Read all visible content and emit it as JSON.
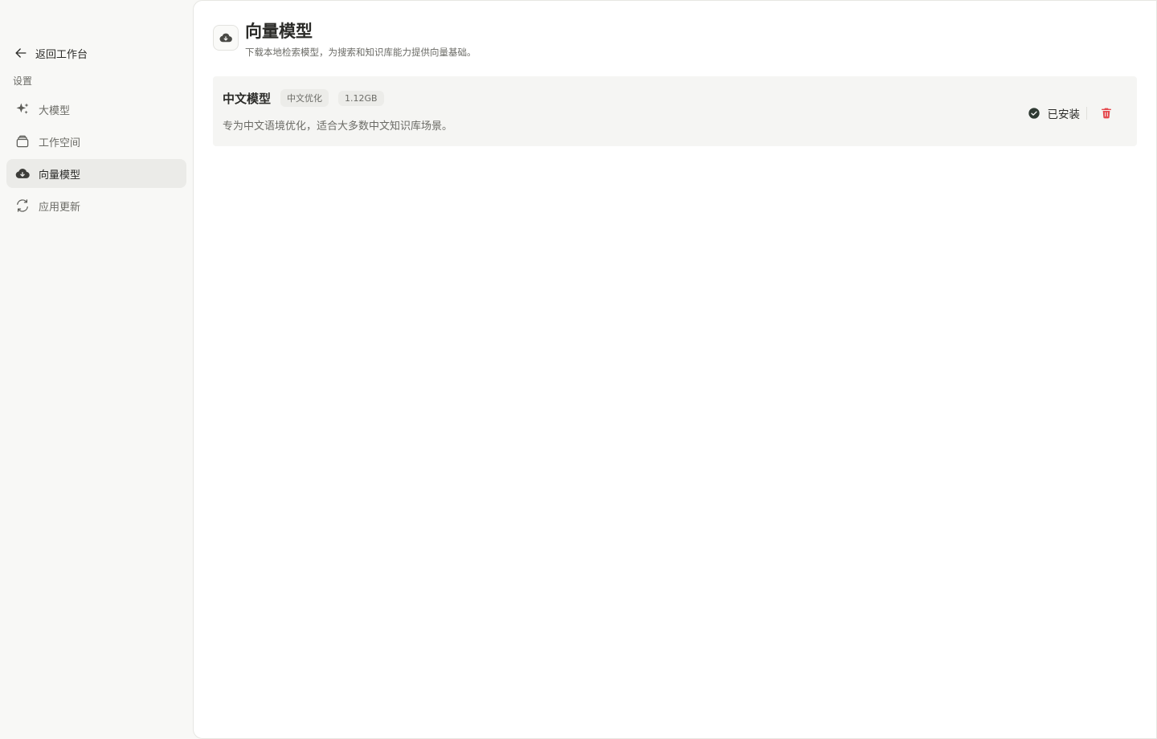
{
  "sidebar": {
    "back_label": "返回工作台",
    "section_label": "设置",
    "items": [
      {
        "label": "大模型",
        "icon": "sparkles-icon",
        "active": false
      },
      {
        "label": "工作空间",
        "icon": "layers-icon",
        "active": false
      },
      {
        "label": "向量模型",
        "icon": "cloud-download-icon",
        "active": true
      },
      {
        "label": "应用更新",
        "icon": "refresh-icon",
        "active": false
      }
    ]
  },
  "main": {
    "header": {
      "icon": "cloud-download-icon",
      "title": "向量模型",
      "subtitle": "下载本地检索模型，为搜索和知识库能力提供向量基础。"
    },
    "models": [
      {
        "name": "中文模型",
        "tags": [
          "中文优化",
          "1.12GB"
        ],
        "description": "专为中文语境优化，适合大多数中文知识库场景。",
        "status": "已安装",
        "status_icon": "check-circle-icon",
        "delete_icon": "trash-icon"
      }
    ]
  },
  "colors": {
    "sidebar_bg": "#f8f8f6",
    "active_nav_bg": "#ebebe8",
    "card_bg": "#f5f5f3",
    "delete_red": "#e5484d",
    "status_dark": "#2f3a33"
  }
}
